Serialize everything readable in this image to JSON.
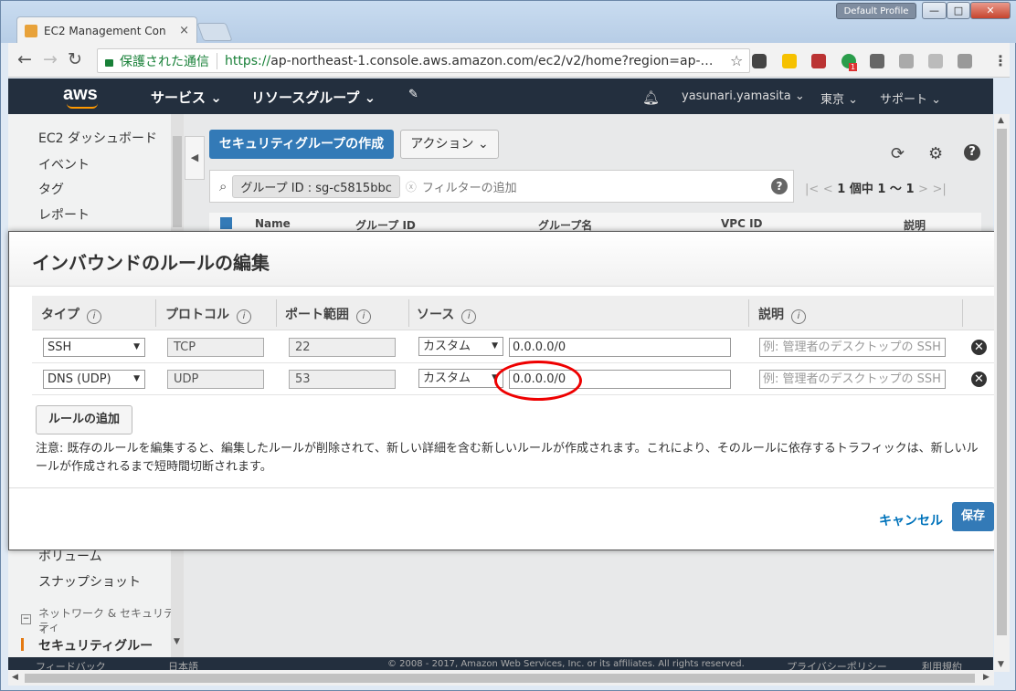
{
  "browser": {
    "tab_title": "EC2 Management Con",
    "tab_close": "×",
    "profile": "Default Profile",
    "secure_label": "保護された通信",
    "url_scheme": "https://",
    "url_rest": "ap-northeast-1.console.aws.amazon.com/ec2/v2/home?region=ap-…",
    "ext_badge": "1"
  },
  "aws_nav": {
    "logo": "aws",
    "services": "サービス ⌄",
    "resource_groups": "リソースグループ ⌄",
    "user": "yasunari.yamasita ⌄",
    "region": "東京 ⌄",
    "support": "サポート ⌄"
  },
  "sidebar": {
    "items": [
      "EC2 ダッシュボード",
      "イベント",
      "タグ",
      "レポート",
      "ボリューム",
      "スナップショット",
      "ネットワーク & セキュリティ",
      "ティ",
      "セキュリティグルー"
    ]
  },
  "toolbar": {
    "create_button": "セキュリティグループの作成",
    "action_button": "アクション ⌄"
  },
  "filter": {
    "chip": "グループ ID : sg-c5815bbc",
    "placeholder": "フィルターの追加",
    "page_info": "1 個中 1 〜 1"
  },
  "table_headers": [
    "Name",
    "グループ ID",
    "グループ名",
    "VPC ID",
    "説明"
  ],
  "modal": {
    "title": "インバウンドのルールの編集",
    "headers": {
      "type": "タイプ",
      "protocol": "プロトコル",
      "port_range": "ポート範囲",
      "source": "ソース",
      "description": "説明"
    },
    "rules": [
      {
        "type": "SSH",
        "protocol": "TCP",
        "port": "22",
        "source_type": "カスタム",
        "source": "0.0.0.0/0",
        "description_placeholder": "例: 管理者のデスクトップの SSH"
      },
      {
        "type": "DNS (UDP)",
        "protocol": "UDP",
        "port": "53",
        "source_type": "カスタム",
        "source": "0.0.0.0/0",
        "description_placeholder": "例: 管理者のデスクトップの SSH"
      }
    ],
    "add_rule": "ルールの追加",
    "note": "注意: 既存のルールを編集すると、編集したルールが削除されて、新しい詳細を含む新しいルールが作成されます。これにより、そのルールに依存するトラフィックは、新しいルールが作成されるまで短時間切断されます。",
    "cancel": "キャンセル",
    "save": "保存"
  },
  "footer": {
    "feedback": "フィードバック",
    "language": "日本語",
    "copyright": "© 2008 - 2017, Amazon Web Services, Inc. or its affiliates. All rights reserved.",
    "privacy": "プライバシーポリシー",
    "terms": "利用規約"
  },
  "colors": {
    "aws_header": "#232f3e",
    "primary_button": "#337ab7",
    "annotation_circle": "#e00000"
  }
}
